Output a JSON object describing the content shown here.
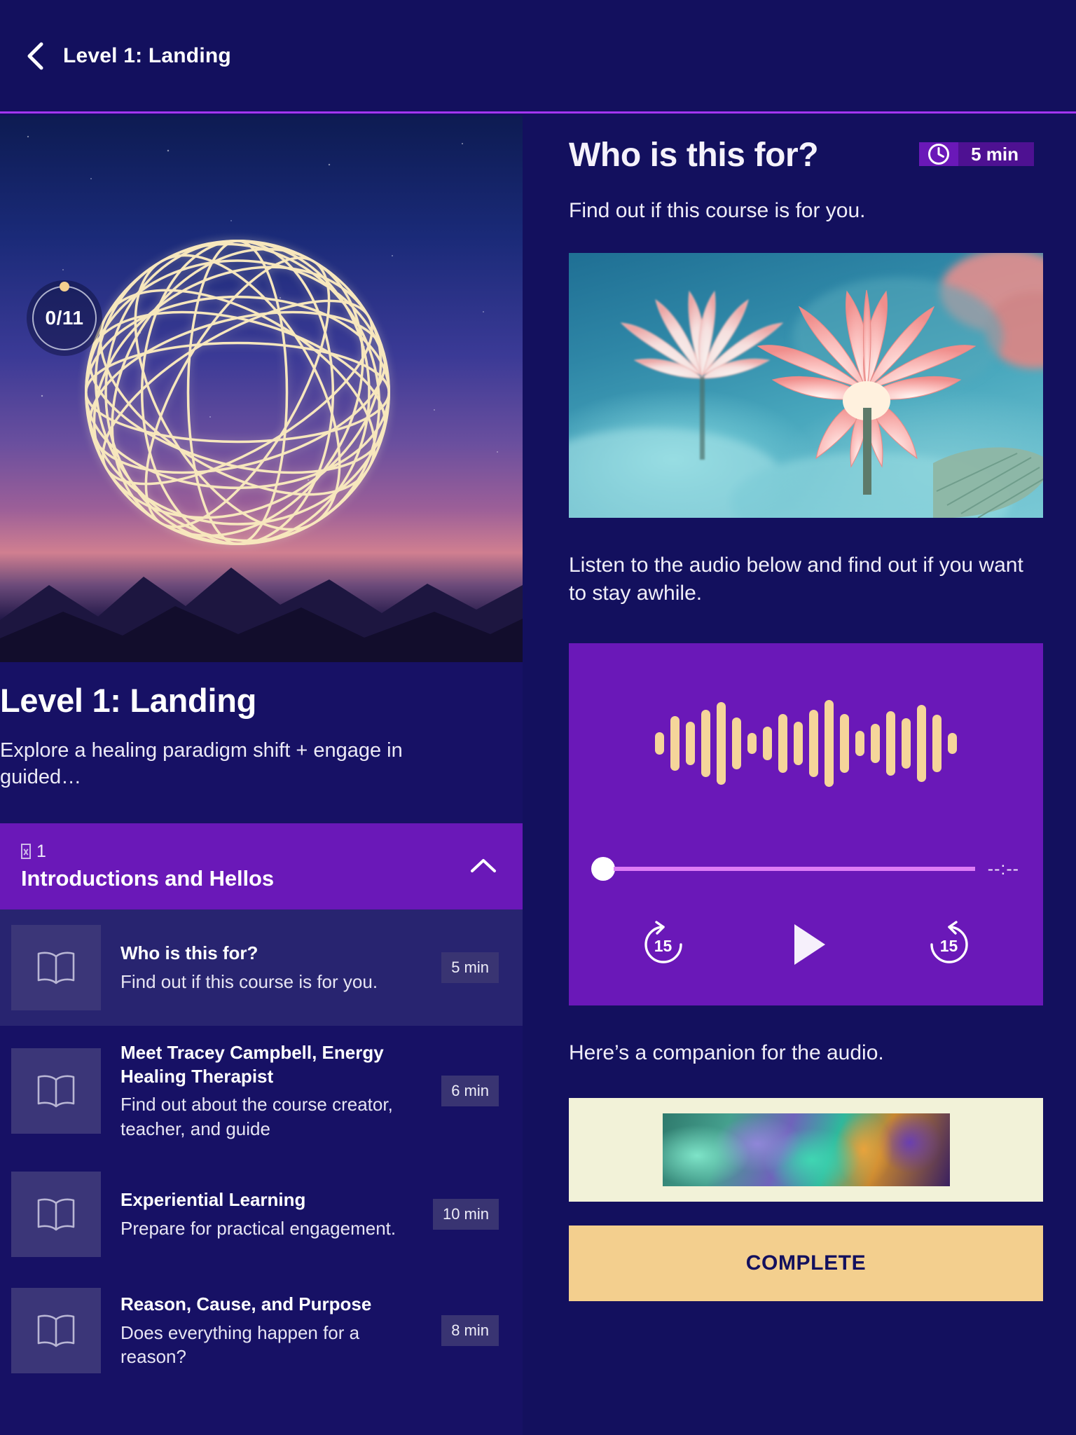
{
  "header": {
    "back_icon": "chevron-left-icon",
    "title": "Level 1: Landing"
  },
  "left_panel": {
    "progress": {
      "label": "0/11",
      "completed": 0,
      "total": 11
    },
    "hero_icon": "wireframe-sphere-graphic",
    "course_title": "Level 1: Landing",
    "course_description": "Explore a healing paradigm shift  + engage in guided…",
    "section": {
      "kicker_icon": "missing-glyph",
      "kicker": "1",
      "name": "Introductions and Hellos",
      "toggle_icon": "chevron-up-icon",
      "expanded": true
    },
    "lessons": [
      {
        "icon": "book-icon",
        "title": "Who is this for?",
        "subtitle": "Find out if this course is for you.",
        "duration": "5 min",
        "active": true
      },
      {
        "icon": "book-icon",
        "title": "Meet Tracey Campbell, Energy Healing Therapist",
        "subtitle": "Find out about the course creator, teacher, and guide",
        "duration": "6 min",
        "active": false
      },
      {
        "icon": "book-icon",
        "title": "Experiential Learning",
        "subtitle": "Prepare for practical engagement.",
        "duration": "10 min",
        "active": false
      },
      {
        "icon": "book-icon",
        "title": "Reason, Cause, and Purpose",
        "subtitle": "Does everything happen for a reason?",
        "duration": "8 min",
        "active": false
      }
    ]
  },
  "right_panel": {
    "title": "Who is this for?",
    "time_badge": {
      "icon": "clock-icon",
      "label": "5 min"
    },
    "subtitle": "Find out if this course is for you.",
    "hero_image_alt": "pink-lotus-flowers-photo",
    "body_text": "Listen to the audio below and find out if you want to stay awhile.",
    "player": {
      "waveform_icon": "audio-waveform",
      "waveform_bars": [
        32,
        78,
        62,
        96,
        118,
        74,
        30,
        48,
        84,
        62,
        96,
        124,
        84,
        36,
        56,
        92,
        72,
        110,
        82,
        30
      ],
      "scrub_position_percent": 0,
      "time_remaining": "--:--",
      "rewind": {
        "icon": "rewind-15-icon",
        "label": "15"
      },
      "play": {
        "icon": "play-icon"
      },
      "forward": {
        "icon": "forward-15-icon",
        "label": "15"
      }
    },
    "companion_text": "Here’s a companion for the audio.",
    "companion_image_alt": "coral-macro-photo",
    "complete_button": "COMPLETE"
  },
  "colors": {
    "page_bg": "#13105e",
    "left_bg": "#171165",
    "accent_purple": "#6a18b8",
    "badge_purple": "#4e1192",
    "divider": "#a435f0",
    "waveform_gold": "#f5d59a",
    "complete_bg": "#f3cf8e",
    "scrub_track": "#dd7cf5"
  }
}
